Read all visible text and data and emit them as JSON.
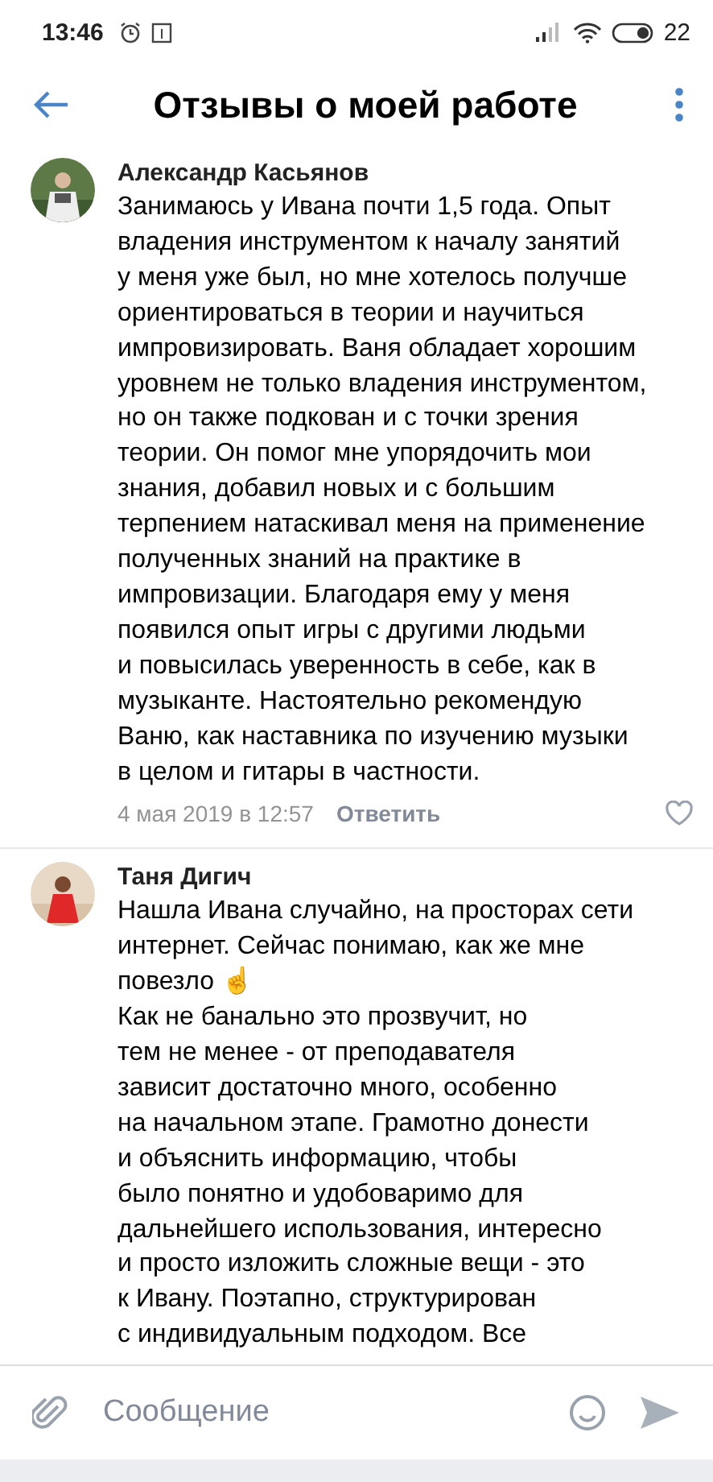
{
  "status_bar": {
    "time": "13:46",
    "battery": "22"
  },
  "header": {
    "title": "Отзывы о моей работе"
  },
  "comments": [
    {
      "author": "Александр Касьянов",
      "avatar": {
        "kind": "picture"
      },
      "paragraphs": [
        "Занимаюсь у Ивана почти 1,5 года. Опыт\nвладения инструментом к началу занятий\nу меня уже был, но мне хотелось получше\nориентироваться в теории и научиться\nимпровизировать. Ваня обладает хорошим\nуровнем не только владения инструментом,\nно он также подкован и с точки зрения\nтеории. Он помог мне упорядочить мои\nзнания, добавил новых и с большим\nтерпением натаскивал меня на применение\nполученных знаний на практике в\nимпровизации. Благодаря ему у меня\nпоявился опыт игры с другими людьми\nи повысилась уверенность в себе, как в\nмузыканте. Настоятельно рекомендую\nВаню, как наставника по изучению музыки\nв целом и гитары в частности."
      ],
      "date": "4 мая 2019 в 12:57",
      "reply": "Ответить",
      "liked": false
    },
    {
      "author": "Таня Дигич",
      "avatar": {
        "kind": "picture"
      },
      "paragraphs": [
        "Нашла Ивана случайно, на просторах сети\nинтернет. Сейчас понимаю, как же мне\nповезло ☝",
        "Как не банально это прозвучит, но\nтем не менее - от преподавателя\nзависит достаточно много, особенно\nна начальном этапе. Грамотно донести\nи объяснить информацию, чтобы\nбыло понятно и удобоваримо для\nдальнейшего использования, интересно\nи просто изложить сложные вещи - это\nк Ивану. Поэтапно, структурирован\nс индивидуальным подходом. Все"
      ]
    }
  ],
  "composer": {
    "placeholder": "Сообщение"
  }
}
